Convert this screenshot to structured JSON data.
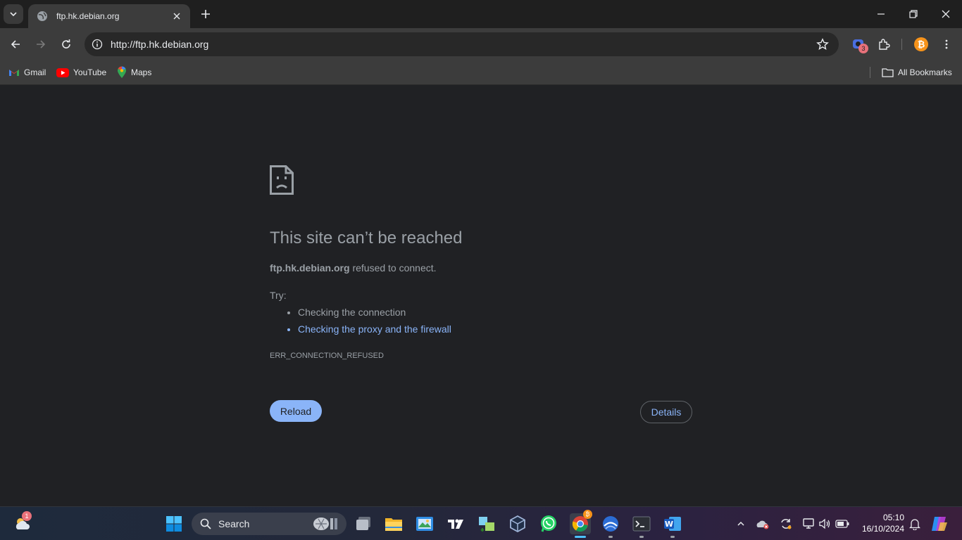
{
  "browser": {
    "tab": {
      "title": "ftp.hk.debian.org"
    },
    "address": {
      "url": "http://ftp.hk.debian.org"
    },
    "extensions": {
      "badge_count": "3"
    },
    "bookmarks": [
      {
        "label": "Gmail",
        "icon": "gmail-icon"
      },
      {
        "label": "YouTube",
        "icon": "youtube-icon"
      },
      {
        "label": "Maps",
        "icon": "maps-icon"
      }
    ],
    "all_bookmarks_label": "All Bookmarks"
  },
  "error_page": {
    "headline": "This site can’t be reached",
    "host": "ftp.hk.debian.org",
    "detail_suffix": " refused to connect.",
    "try_label": "Try:",
    "suggestions": [
      "Checking the connection",
      "Checking the proxy and the firewall"
    ],
    "error_code": "ERR_CONNECTION_REFUSED",
    "reload_label": "Reload",
    "details_label": "Details"
  },
  "taskbar": {
    "search_placeholder": "Search",
    "weather_badge": "1",
    "clock_time": "05:10",
    "clock_date": "16/10/2024"
  },
  "colors": {
    "accent": "#8ab4f8",
    "background": "#202124",
    "muted_text": "#9aa0a6"
  }
}
